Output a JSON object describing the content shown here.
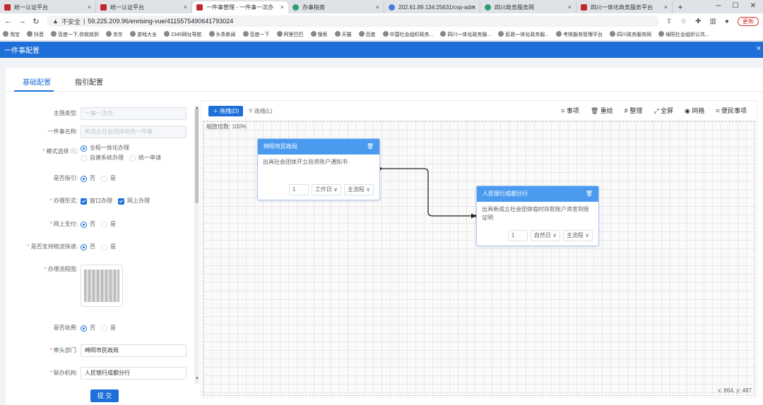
{
  "browser": {
    "tabs": [
      {
        "label": "统一认证平台",
        "icon": "r"
      },
      {
        "label": "统一认证平台",
        "icon": "r"
      },
      {
        "label": "一件事管理 - 一件事一次办",
        "icon": "r"
      },
      {
        "label": "办事指南",
        "icon": "g"
      },
      {
        "label": "202.61.89.134:25631/cvp-adm",
        "icon": "b"
      },
      {
        "label": "四川政务服务网",
        "icon": "g"
      },
      {
        "label": "四川一体化政务服务平台",
        "icon": "r"
      }
    ],
    "close_glyph": "×",
    "new_tab_glyph": "+",
    "address": {
      "warning": "不安全",
      "separator": "|",
      "url": "59.225.209.96/enrising-vue/4115575490641793024"
    },
    "update_label": "更新",
    "bookmarks": [
      "淘宝",
      "抖音",
      "百度一下,你就就到",
      "京东",
      "游戏大全",
      "2345网址导航",
      "头条新闻",
      "百度一下",
      "阿里巴巴",
      "搜索",
      "天猫",
      "百度",
      "中国社会组织政务...",
      "四川一体化政务服...",
      "民政一体化政务服...",
      "考核服务管理平台",
      "四川政务服务网",
      "绵阳社会组织公共..."
    ]
  },
  "header": {
    "title": "一件事配置",
    "close_glyph": "×"
  },
  "tabs": {
    "basic": "基础配置",
    "guide": "指引配置"
  },
  "form": {
    "theme_type": {
      "label": "主题类型:",
      "value": "一事一次办"
    },
    "item_name": {
      "label": "一件事名称:",
      "value": "新成立社会团体验资一件事"
    },
    "mode": {
      "label": "模式选择",
      "opt1": "全程一体化办理",
      "opt2": "自建系统办理",
      "opt3": "统一申请"
    },
    "guidance": {
      "label": "是否指引:",
      "no": "否",
      "yes": "是"
    },
    "handle_form": {
      "label": "办理形式:",
      "opt1": "窗口办理",
      "opt2": "网上办理"
    },
    "online_pay": {
      "label": "网上支付:",
      "no": "否",
      "yes": "是"
    },
    "logistics": {
      "label": "是否支持物流快递:",
      "no": "否",
      "yes": "是"
    },
    "flow_chart": {
      "label": "办理流程图:"
    },
    "charge": {
      "label": "是否收费:",
      "no": "否",
      "yes": "是"
    },
    "lead_dept": {
      "label": "牵头部门:",
      "value": "绵阳市民政局"
    },
    "co_org": {
      "label": "联办机构:",
      "value": "人民银行成都分行"
    },
    "submit": "提 交"
  },
  "canvas": {
    "drag_btn": "拖拽(D)",
    "connect_btn": "连线(L)",
    "tools": [
      "事项",
      "重绘",
      "整理",
      "全屏",
      "网格",
      "便民事项"
    ],
    "zoom_label": "缩放倍数: 100%",
    "coord_label": "x: 864, y: 487",
    "nodes": [
      {
        "title": "绵阳市民政局",
        "desc": "出具社会团体开立验资账户通知书",
        "days": "1",
        "day_type": "工作日",
        "flow": "主流程"
      },
      {
        "title": "人民银行成都分行",
        "desc": "出具新成立社会团体临时存款账户资金到账证明",
        "days": "1",
        "day_type": "自然日",
        "flow": "主流程"
      }
    ]
  },
  "colors": {
    "primary": "#1e6fd9",
    "node_header": "#4a9bf0"
  }
}
